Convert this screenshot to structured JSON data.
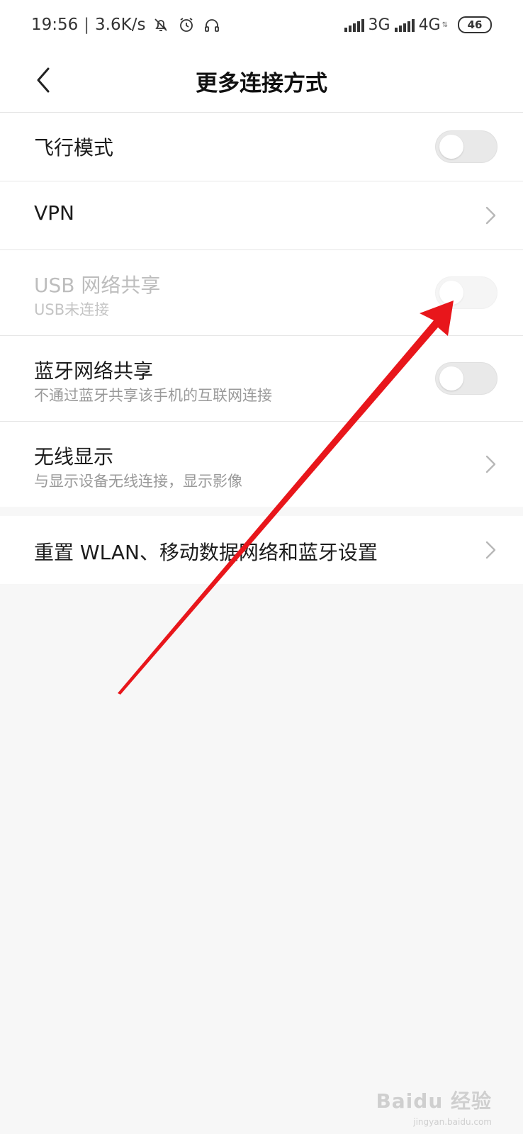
{
  "status_bar": {
    "time": "19:56",
    "separator": "|",
    "net_speed": "3.6K/s",
    "icons_left": [
      "bell-off-icon",
      "alarm-icon",
      "headphone-icon"
    ],
    "network_1": "3G",
    "network_2": "4G",
    "battery": "46"
  },
  "header": {
    "title": "更多连接方式",
    "back_icon": "chevron-left-icon"
  },
  "settings": {
    "airplane": {
      "title": "飞行模式",
      "toggle_on": false
    },
    "vpn": {
      "title": "VPN"
    },
    "usb_tethering": {
      "title": "USB 网络共享",
      "subtitle": "USB未连接",
      "toggle_on": false,
      "disabled": true
    },
    "bt_tethering": {
      "title": "蓝牙网络共享",
      "subtitle": "不通过蓝牙共享该手机的互联网连接",
      "toggle_on": false
    },
    "wireless_display": {
      "title": "无线显示",
      "subtitle": "与显示设备无线连接，显示影像"
    },
    "reset": {
      "title": "重置 WLAN、移动数据网络和蓝牙设置"
    }
  },
  "annotation": {
    "arrow_color": "#e8161b"
  },
  "watermark": {
    "text": "Baidu 经验",
    "sub": "jingyan.baidu.com"
  },
  "colors": {
    "background": "#f7f7f7",
    "card": "#ffffff",
    "toggle_off": "#e9e9e9",
    "annotation": "#e8161b"
  }
}
